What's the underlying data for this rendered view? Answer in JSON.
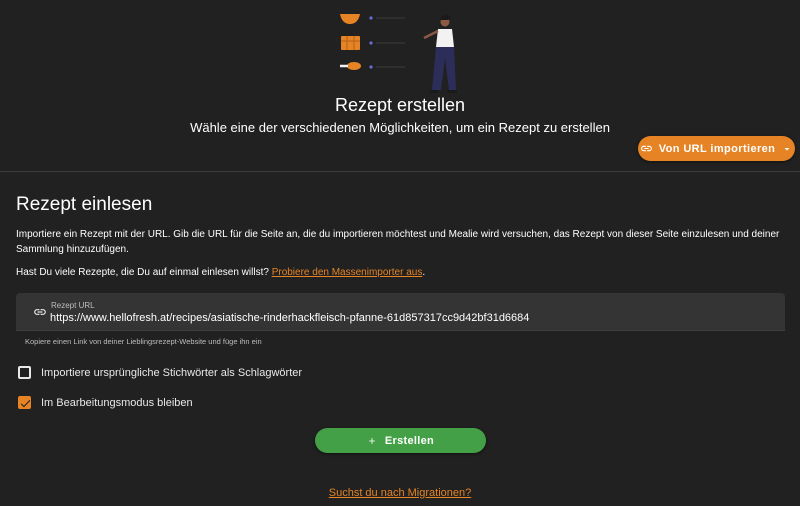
{
  "hero": {
    "title": "Rezept erstellen",
    "subtitle": "Wähle eine der verschiedenen Möglichkeiten, um ein Rezept zu erstellen",
    "import_button_label": "Von URL importieren",
    "import_button_icon": "link-icon"
  },
  "section": {
    "title": "Rezept einlesen",
    "description": "Importiere ein Rezept mit der URL. Gib die URL für die Seite an, die du importieren möchtest und Mealie wird versuchen, das Rezept von dieser Seite einzulesen und deiner Sammlung hinzuzufügen.",
    "bulk_question": "Hast Du viele Rezepte, die Du auf einmal einlesen willst?",
    "bulk_link": "Probiere den Massenimporter aus",
    "bulk_suffix": "."
  },
  "url_field": {
    "icon": "link-icon",
    "label": "Rezept URL",
    "value": "https://www.hellofresh.at/recipes/asiatische-rinderhackfleisch-pfanne-61d857317cc9d42bf31d6684",
    "hint": "Kopiere einen Link von deiner Lieblingsrezept-Website und füge ihn ein"
  },
  "options": [
    {
      "label": "Importiere ursprüngliche Stichwörter als Schlagwörter",
      "checked": false
    },
    {
      "label": "Im Bearbeitungsmodus bleiben",
      "checked": true
    }
  ],
  "create_button": {
    "label": "Erstellen",
    "icon": "plus-icon"
  },
  "migration_link": "Suchst du nach Migrationen?",
  "colors": {
    "background": "#212121",
    "accent": "#e58325",
    "success": "#43a047",
    "field": "#343434"
  }
}
